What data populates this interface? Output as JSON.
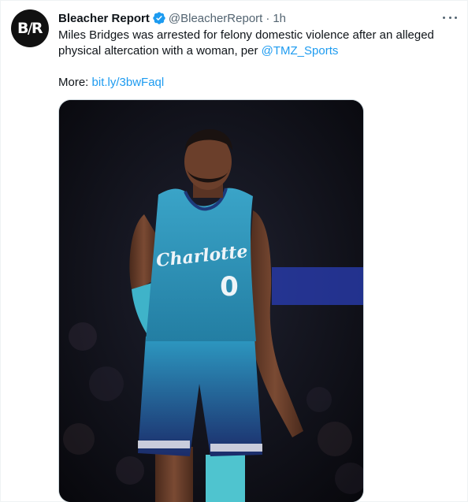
{
  "tweet": {
    "author": {
      "display_name": "Bleacher Report",
      "handle": "@BleacherReport",
      "avatar_text_left": "B",
      "avatar_text_slash": "/",
      "avatar_text_right": "R",
      "verified_icon": "verified-badge-icon"
    },
    "separator": "·",
    "time": "1h",
    "more_icon": "more-horizontal-icon",
    "text_line1": "Miles Bridges was arrested for felony domestic violence after an alleged",
    "text_line2_prefix": "physical altercation with a woman, per ",
    "text_line2_mention": "@TMZ_Sports",
    "more_label": "More: ",
    "more_link": "bit.ly/3bwFaql",
    "media": {
      "jersey_text": "Charlotte",
      "jersey_number": "0"
    }
  },
  "colors": {
    "link": "#1d9bf0",
    "secondary_text": "#536471",
    "verified": "#1d9bf0",
    "jersey": "#2a8fb5"
  }
}
